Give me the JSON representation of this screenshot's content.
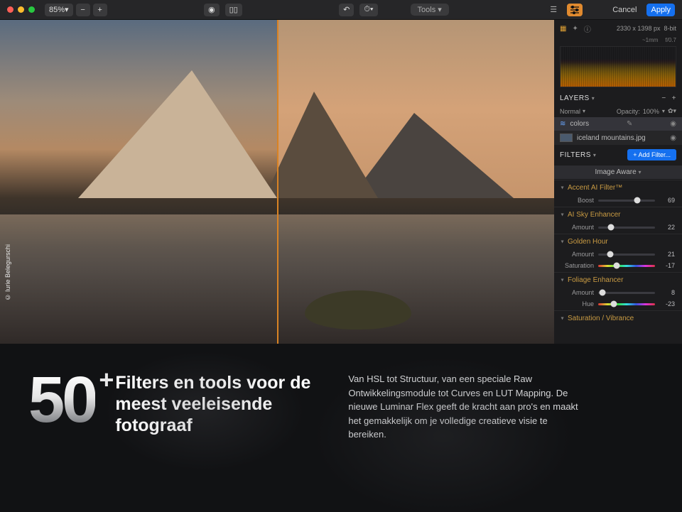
{
  "toolbar": {
    "zoom": "85%",
    "tools_label": "Tools",
    "cancel": "Cancel",
    "apply": "Apply"
  },
  "meta": {
    "dimensions": "2330 x 1398 px",
    "depth": "8-bit",
    "exif_focal": "~1mm",
    "exif_aperture": "f/0.7"
  },
  "credit": "© Iurie Belegurschi",
  "layers": {
    "title": "LAYERS",
    "blend_mode": "Normal",
    "opacity_label": "Opacity:",
    "opacity_value": "100%",
    "items": [
      {
        "name": "colors"
      },
      {
        "name": "iceland mountains.jpg"
      }
    ]
  },
  "filters_panel": {
    "title": "FILTERS",
    "add_label": "+ Add Filter...",
    "preset": "Image Aware"
  },
  "filters": [
    {
      "name": "Accent AI Filter™",
      "params": [
        {
          "label": "Boost",
          "value": 69,
          "pct": 69
        }
      ]
    },
    {
      "name": "AI Sky Enhancer",
      "params": [
        {
          "label": "Amount",
          "value": 22,
          "pct": 22
        }
      ]
    },
    {
      "name": "Golden Hour",
      "params": [
        {
          "label": "Amount",
          "value": 21,
          "pct": 21
        },
        {
          "label": "Saturation",
          "value": -17,
          "pct": 33,
          "rainbow": true
        }
      ]
    },
    {
      "name": "Foliage Enhancer",
      "params": [
        {
          "label": "Amount",
          "value": 8,
          "pct": 8
        },
        {
          "label": "Hue",
          "value": -23,
          "pct": 27,
          "rainbow": true
        }
      ]
    },
    {
      "name": "Saturation / Vibrance",
      "params": []
    }
  ],
  "marketing": {
    "number": "50",
    "plus": "+",
    "headline": "Filters en tools voor de meest veeleisende fotograaf",
    "body": "Van HSL tot Structuur, van een speciale Raw Ontwikkelingsmodule tot Curves en LUT Mapping. De nieuwe Luminar Flex geeft de kracht aan pro's en maakt het gemakkelijk om je volledige creatieve visie te bereiken."
  }
}
